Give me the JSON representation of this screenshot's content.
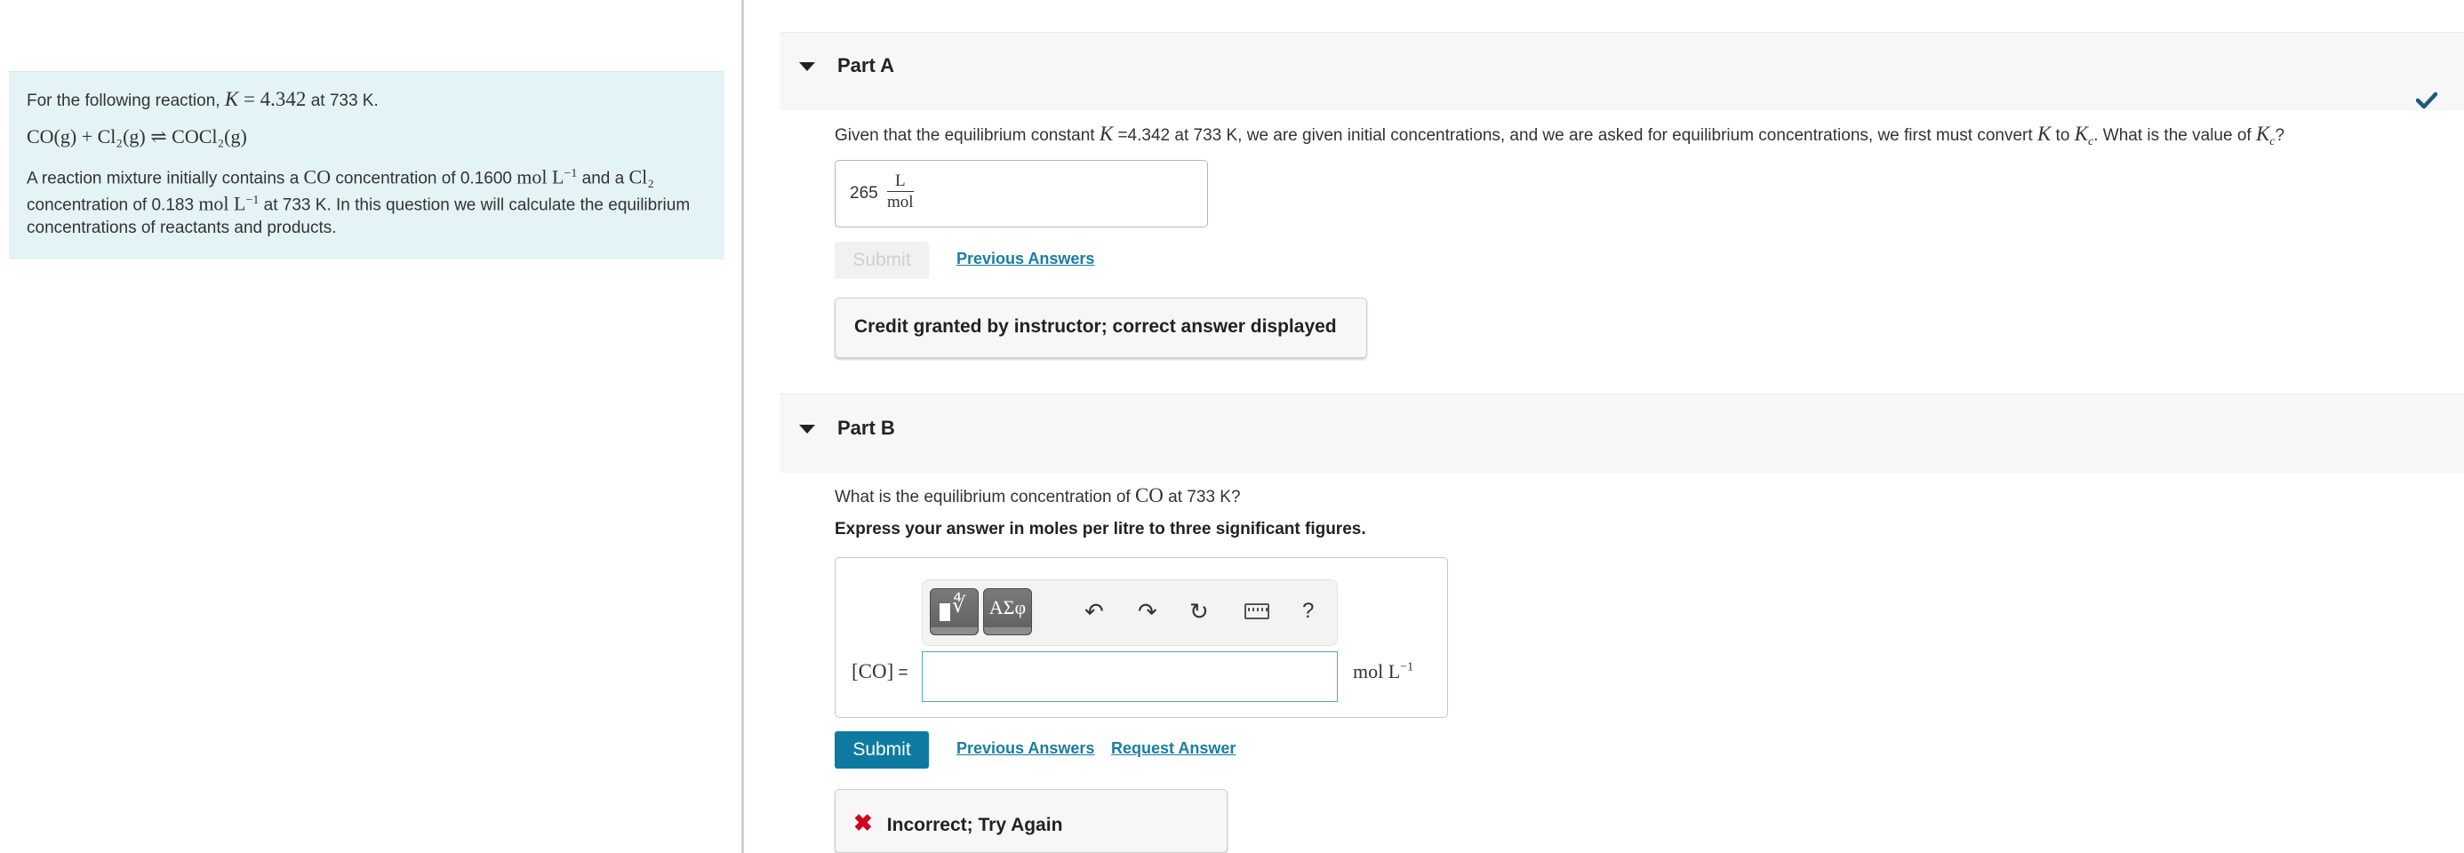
{
  "intro": {
    "line1_prefix": "For the following reaction, ",
    "k_symbol": "K",
    "k_expr": " = 4.342",
    "line1_suffix": "  at 733 K.",
    "equation": "CO(g) + Cl₂(g) ⇌ COCl₂(g)",
    "para_a": "A reaction mixture initially contains a ",
    "para_co": "CO",
    "para_b": " concentration of 0.1600 ",
    "para_unit1": "mol L",
    "para_exp": "−1",
    "para_c": " and a ",
    "para_cl2": "Cl₂",
    "para_d": " concentration of 0.183 ",
    "para_unit2": "mol L",
    "para_e": " at 733 K.  In this question we will calculate the equilibrium concentrations of reactants and products."
  },
  "partA": {
    "title": "Part A",
    "status_icon": "checkmark-icon",
    "question_a": "Given that the equilibrium constant ",
    "question_k": "K",
    "question_b": " =4.342 at 733 K, we are given initial concentrations, and we are asked for equilibrium concentrations, we first must convert ",
    "question_k2": "K",
    "question_c": " to ",
    "question_kc": "K",
    "question_kc_sub": "c",
    "question_d": ". What is the value of ",
    "question_kc2": "K",
    "question_e": "?",
    "answer_value": "265",
    "answer_unit_num": "L",
    "answer_unit_den": "mol",
    "submit_label": "Submit",
    "previous_answers_label": "Previous Answers",
    "feedback": "Credit granted by instructor; correct answer displayed"
  },
  "partB": {
    "title": "Part B",
    "question_a": "What is the equilibrium concentration of ",
    "question_co": "CO",
    "question_b": " at 733 K?",
    "instruction": "Express your answer in moles per litre to three significant figures.",
    "toolbar": {
      "templates_icon": "templates-root-icon",
      "symbols_label": "ΑΣφ",
      "undo_icon": "undo-icon",
      "redo_icon": "redo-icon",
      "reset_icon": "reset-icon",
      "keyboard_icon": "keyboard-icon",
      "help_label": "?"
    },
    "input_label": "[CO]",
    "input_equals": " =",
    "input_value": "",
    "units": "mol L",
    "units_exp": "−1",
    "submit_label": "Submit",
    "previous_answers_label": "Previous Answers",
    "request_answer_label": "Request Answer",
    "feedback": "Incorrect; Try Again"
  },
  "colors": {
    "intro_bg": "#e4f3f6",
    "accent": "#0f7aa1",
    "link": "#1a7da3",
    "check": "#1b5a7a",
    "error": "#d0021b"
  }
}
